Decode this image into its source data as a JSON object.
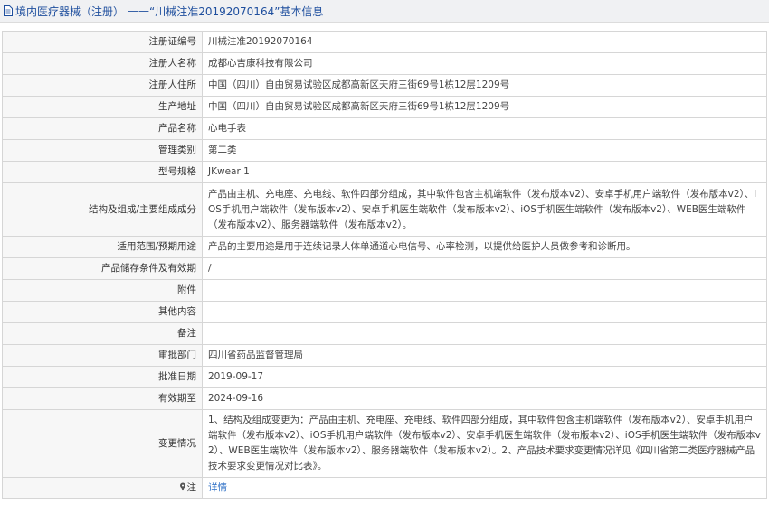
{
  "header": {
    "category": "境内医疗器械（注册）",
    "separator": "——",
    "record_title": "“川械注准20192070164”基本信息"
  },
  "rows": [
    {
      "label": "注册证编号",
      "value": "川械注准20192070164"
    },
    {
      "label": "注册人名称",
      "value": "成都心吉康科技有限公司"
    },
    {
      "label": "注册人住所",
      "value": "中国（四川）自由贸易试验区成都高新区天府三街69号1栋12层1209号"
    },
    {
      "label": "生产地址",
      "value": "中国（四川）自由贸易试验区成都高新区天府三街69号1栋12层1209号"
    },
    {
      "label": "产品名称",
      "value": "心电手表"
    },
    {
      "label": "管理类别",
      "value": "第二类"
    },
    {
      "label": "型号规格",
      "value": "JKwear 1"
    },
    {
      "label": "结构及组成/主要组成成分",
      "value": "产品由主机、充电座、充电线、软件四部分组成，其中软件包含主机端软件（发布版本v2）、安卓手机用户端软件（发布版本v2）、iOS手机用户端软件（发布版本v2）、安卓手机医生端软件（发布版本v2）、iOS手机医生端软件（发布版本v2）、WEB医生端软件（发布版本v2）、服务器端软件（发布版本v2）。"
    },
    {
      "label": "适用范围/预期用途",
      "value": "产品的主要用途是用于连续记录人体单通道心电信号、心率检测，以提供给医护人员做参考和诊断用。"
    },
    {
      "label": "产品储存条件及有效期",
      "value": "/"
    },
    {
      "label": "附件",
      "value": ""
    },
    {
      "label": "其他内容",
      "value": ""
    },
    {
      "label": "备注",
      "value": ""
    },
    {
      "label": "审批部门",
      "value": "四川省药品监督管理局"
    },
    {
      "label": "批准日期",
      "value": "2019-09-17"
    },
    {
      "label": "有效期至",
      "value": "2024-09-16"
    },
    {
      "label": "变更情况",
      "value": "1、结构及组成变更为：产品由主机、充电座、充电线、软件四部分组成，其中软件包含主机端软件（发布版本v2）、安卓手机用户端软件（发布版本v2）、iOS手机用户端软件（发布版本v2）、安卓手机医生端软件（发布版本v2）、iOS手机医生端软件（发布版本v2）、WEB医生端软件（发布版本v2）、服务器端软件（发布版本v2）。2、产品技术要求变更情况详见《四川省第二类医疗器械产品技术要求变更情况对比表》。"
    }
  ],
  "note_row": {
    "label": "注",
    "link_text": "详情"
  },
  "icons": {
    "title_icon": "document-icon",
    "note_icon": "pin-icon"
  },
  "colors": {
    "title_text": "#1f4f9e",
    "link": "#2a6dc5",
    "label_bg": "#f7f7f7",
    "border": "#d6d6d6"
  }
}
